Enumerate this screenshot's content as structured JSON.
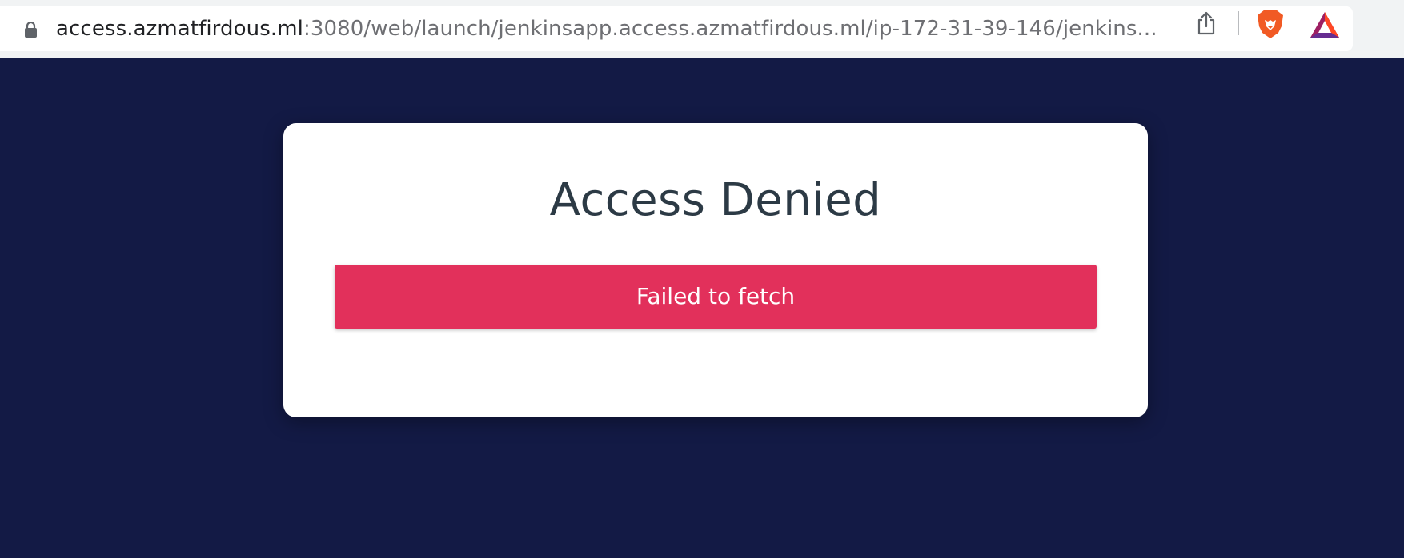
{
  "browser": {
    "url_host": "access.azmatfirdous.ml",
    "url_path": ":3080/web/launch/jenkinsapp.access.azmatfirdous.ml/ip-172-31-39-146/jenkins...",
    "icons": {
      "lock": "lock-icon",
      "share": "share-icon",
      "brave": "brave-lion-icon",
      "rewards": "bat-triangle-icon"
    }
  },
  "page": {
    "title": "Access Denied",
    "error_message": "Failed to fetch",
    "colors": {
      "background": "#131a45",
      "error": "#e2305b",
      "title": "#2c3a45"
    }
  }
}
